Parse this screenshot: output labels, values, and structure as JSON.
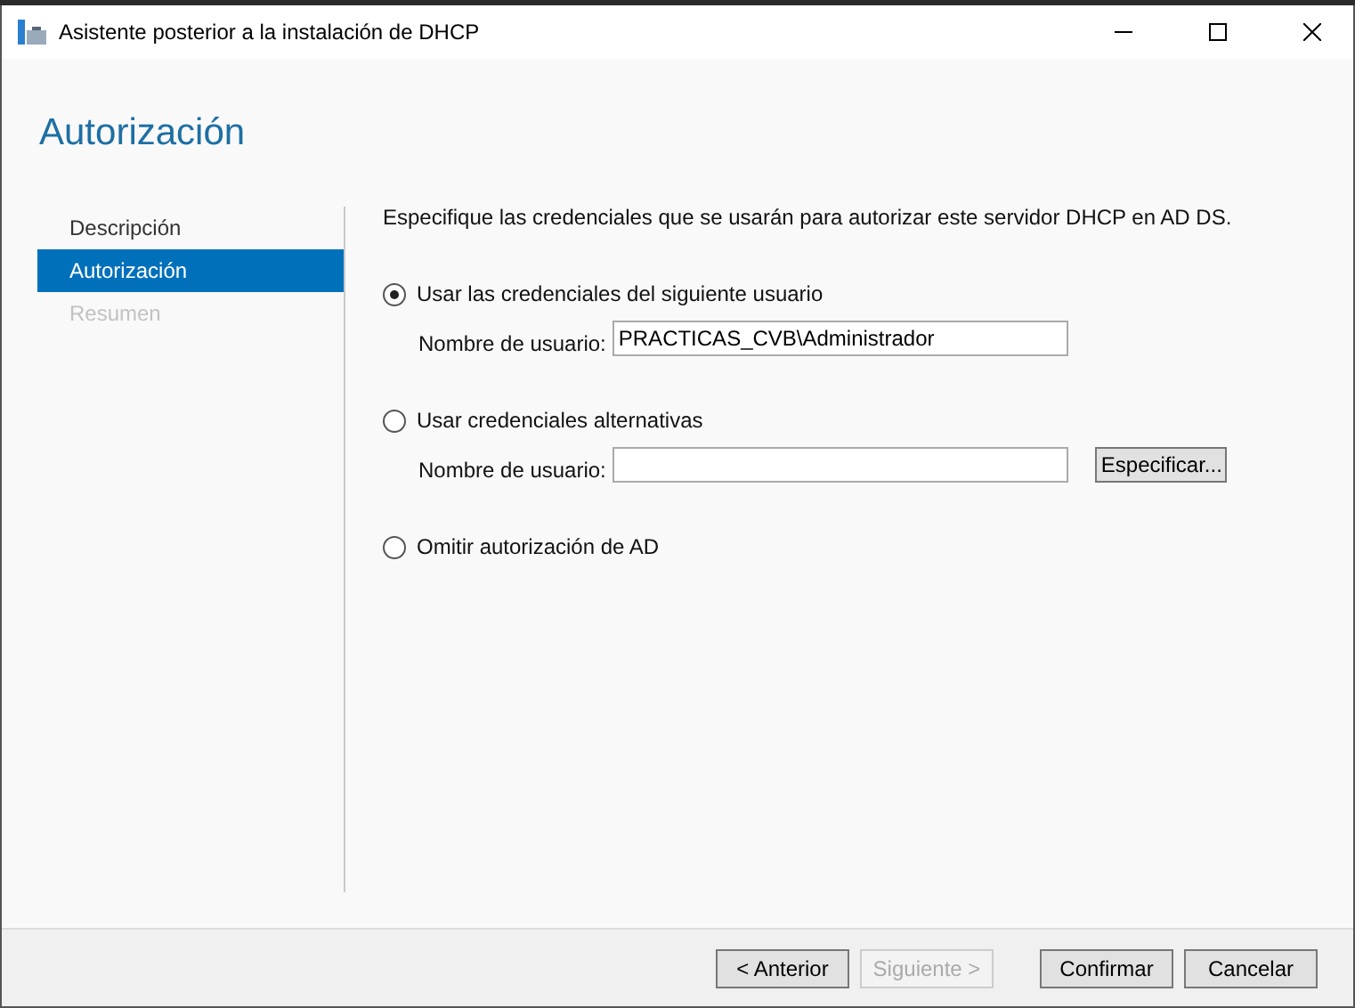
{
  "window": {
    "title": "Asistente posterior a la instalación de DHCP"
  },
  "heading": "Autorización",
  "steps": [
    {
      "label": "Descripción",
      "selected": false,
      "disabled": false
    },
    {
      "label": "Autorización",
      "selected": true,
      "disabled": false
    },
    {
      "label": "Resumen",
      "selected": false,
      "disabled": true
    }
  ],
  "intro": "Especifique las credenciales que se usarán para autorizar este servidor DHCP en AD DS.",
  "options": [
    {
      "label": "Usar las credenciales del siguiente usuario",
      "selected": true,
      "field": {
        "label": "Nombre de usuario:",
        "value": "PRACTICAS_CVB\\Administrador"
      }
    },
    {
      "label": "Usar credenciales alternativas",
      "selected": false,
      "field": {
        "label": "Nombre de usuario:"
      },
      "button": "Especificar..."
    },
    {
      "label": "Omitir autorización de AD",
      "selected": false
    }
  ],
  "footer_buttons": [
    {
      "label": "< Anterior",
      "disabled": false
    },
    {
      "label": "Siguiente >",
      "disabled": true
    },
    {
      "label": "Confirmar",
      "disabled": false
    },
    {
      "label": "Cancelar",
      "disabled": false
    }
  ]
}
